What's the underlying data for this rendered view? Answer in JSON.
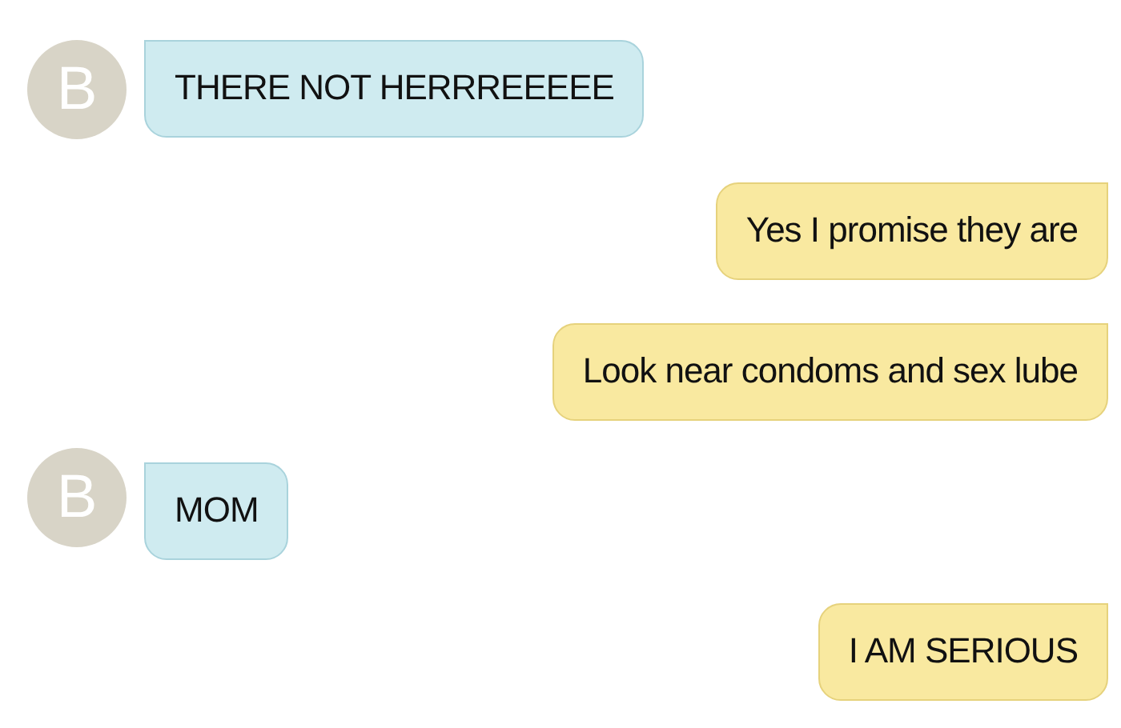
{
  "messages": [
    {
      "kind": "incoming",
      "avatar": "B",
      "text": "THERE NOT HERRREEEEE"
    },
    {
      "kind": "outgoing",
      "text": "Yes I promise they are"
    },
    {
      "kind": "outgoing",
      "text": "Look near condoms and sex lube"
    },
    {
      "kind": "incoming",
      "avatar": "B",
      "text": "MOM"
    },
    {
      "kind": "outgoing",
      "text": "I AM SERIOUS"
    }
  ]
}
